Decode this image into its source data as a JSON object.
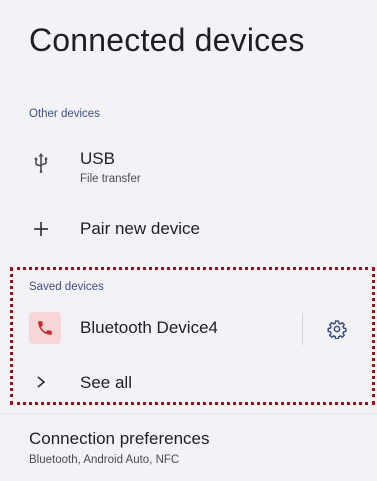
{
  "header": {
    "title": "Connected devices"
  },
  "other_devices": {
    "section_label": "Other devices",
    "usb": {
      "title": "USB",
      "subtitle": "File transfer",
      "icon": "usb-icon"
    },
    "pair_new": {
      "title": "Pair new device",
      "icon": "plus-icon"
    }
  },
  "saved_devices": {
    "section_label": "Saved devices",
    "device": {
      "title": "Bluetooth Device4",
      "icon": "phone-icon",
      "settings_icon": "gear-icon"
    },
    "see_all": {
      "title": "See all",
      "icon": "chevron-right-icon"
    }
  },
  "connection_preferences": {
    "title": "Connection preferences",
    "subtitle": "Bluetooth, Android Auto, NFC"
  },
  "colors": {
    "background": "#f3f3f7",
    "section_label": "#3d4f8a",
    "phone_badge_bg": "#f6d6d8",
    "phone_icon": "#c4282c",
    "settings_icon": "#3d4f8a",
    "highlight_border": "#a30f16"
  }
}
